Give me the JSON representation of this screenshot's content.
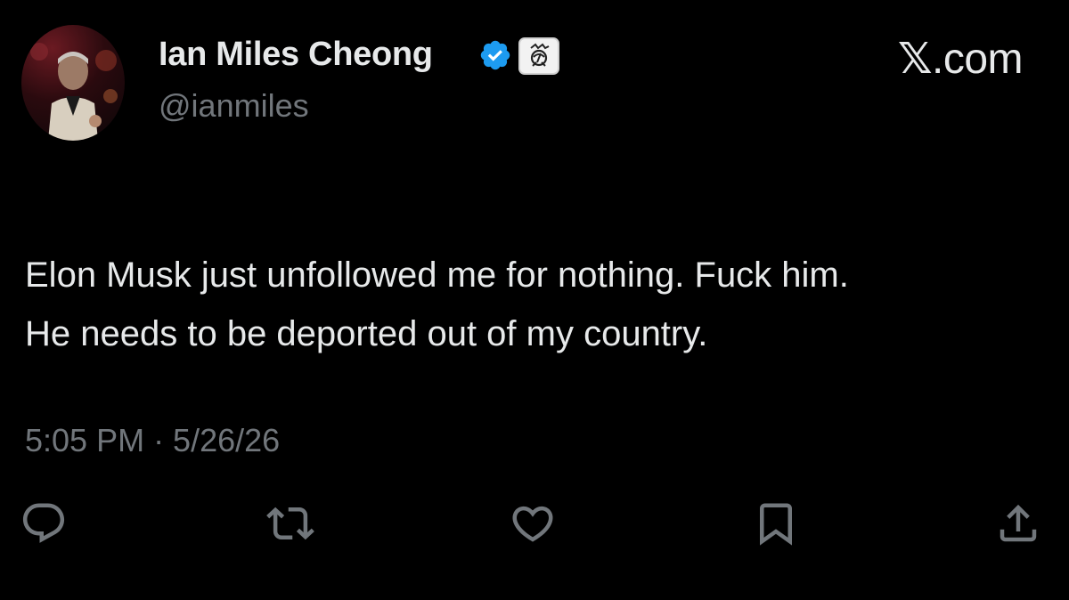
{
  "post": {
    "author": {
      "display_name": "Ian Miles Cheong",
      "handle": "@ianmiles",
      "verified": true
    },
    "site": {
      "x_glyph": "𝕏",
      "suffix": ".com"
    },
    "text_lines": [
      "Elon Musk just unfollowed me for nothing. Fuck him.",
      "He needs to be deported out of my country."
    ],
    "timestamp": "5:05 PM · 5/26/26",
    "actions": [
      "reply-icon",
      "repost-icon",
      "like-icon",
      "bookmark-icon",
      "share-icon"
    ]
  },
  "colors": {
    "background": "#000000",
    "primary_text": "#e7e9ea",
    "secondary_text": "#71767b",
    "verified_blue": "#1d9bf0"
  }
}
